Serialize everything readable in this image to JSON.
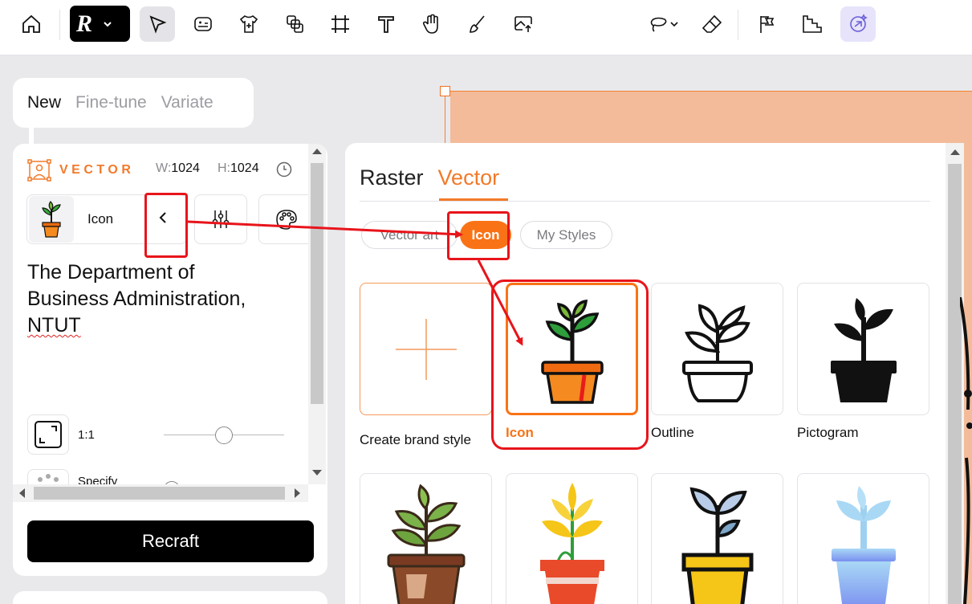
{
  "toolbar": {
    "tools": [
      {
        "name": "home-icon"
      },
      {
        "name": "select-arrow-icon"
      },
      {
        "name": "mockup-icon"
      },
      {
        "name": "tshirt-add-icon"
      },
      {
        "name": "layers-icon"
      },
      {
        "name": "frame-icon"
      },
      {
        "name": "text-icon"
      },
      {
        "name": "hand-icon"
      },
      {
        "name": "brush-icon"
      },
      {
        "name": "image-upload-icon"
      },
      {
        "name": "lasso-icon"
      },
      {
        "name": "eraser-icon"
      },
      {
        "name": "flags-icon"
      },
      {
        "name": "stairs-icon"
      },
      {
        "name": "ai-assist-icon"
      }
    ],
    "brand_logo": "R"
  },
  "mode_tabs": [
    {
      "label": "New",
      "active": true
    },
    {
      "label": "Fine-tune",
      "active": false
    },
    {
      "label": "Variate",
      "active": false
    }
  ],
  "left_panel": {
    "type_label": "VECTOR",
    "width_key": "W:",
    "width_value": "1024",
    "height_key": "H:",
    "height_value": "1024",
    "style_name": "Icon",
    "prompt_line1": "The Department of",
    "prompt_line2": "Business Administration,",
    "prompt_line3": "NTUT",
    "ratio_label": "1:1",
    "ratio_value": 0.47,
    "specify_label": "Specify",
    "recraft_label": "Recraft"
  },
  "picker": {
    "tabs": [
      {
        "label": "Raster",
        "active": false
      },
      {
        "label": "Vector",
        "active": true
      }
    ],
    "chips": [
      {
        "label": "Vector art",
        "active": false
      },
      {
        "label": "Icon",
        "active": true
      },
      {
        "label": "My Styles",
        "active": false
      }
    ],
    "cards": [
      {
        "label": "Create brand style"
      },
      {
        "label": "Icon",
        "selected": true
      },
      {
        "label": "Outline"
      },
      {
        "label": "Pictogram"
      }
    ]
  },
  "colors": {
    "accent": "#f97316",
    "canvas": "#f3bb9a",
    "annotation": "#e8141b"
  }
}
